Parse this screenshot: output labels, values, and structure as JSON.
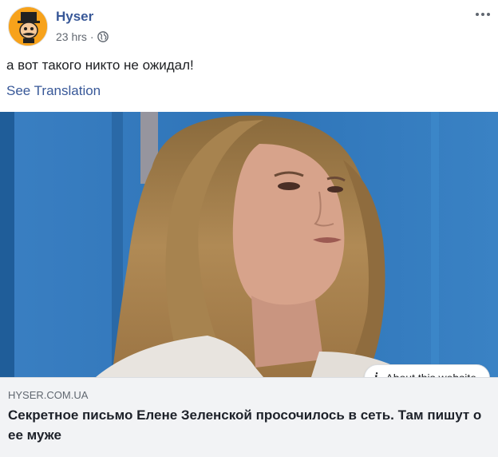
{
  "post": {
    "author": "Hyser",
    "time": "23 hrs",
    "separator": "·",
    "text": "а вот такого никто не ожидал!",
    "see_translation": "See Translation"
  },
  "icons": {
    "avatar": "hyser-logo-avatar",
    "privacy": "globe-icon",
    "more": "more-options-icon",
    "info": "info-icon"
  },
  "link_preview": {
    "about_label": "About this website",
    "info_glyph": "i",
    "domain": "HYSER.COM.UA",
    "headline": "Секретное письмо Елене Зеленской просочилось в сеть. Там пишут о ее муже"
  },
  "colors": {
    "author_link": "#385898",
    "meta_gray": "#616770",
    "link_box_bg": "#f2f3f5",
    "avatar_orange": "#f7a21b"
  }
}
